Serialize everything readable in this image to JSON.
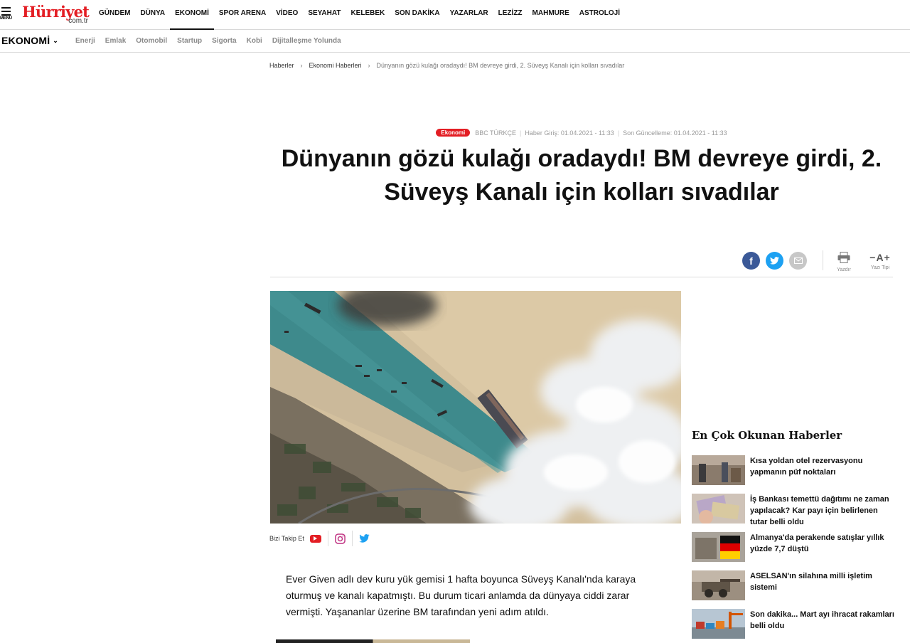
{
  "header": {
    "menu_label": "MENÜ",
    "logo_text": "Hürriyet",
    "logo_domain": "com.tr",
    "nav": [
      "GÜNDEM",
      "DÜNYA",
      "EKONOMİ",
      "SPOR ARENA",
      "VİDEO",
      "SEYAHAT",
      "KELEBEK",
      "SON DAKİKA",
      "YAZARLAR",
      "LEZİZZ",
      "MAHMURE",
      "ASTROLOJİ"
    ],
    "active_nav": "EKONOMİ"
  },
  "subheader": {
    "section": "EKONOMİ",
    "items": [
      "Enerji",
      "Emlak",
      "Otomobil",
      "Startup",
      "Sigorta",
      "Kobi",
      "Dijitalleşme Yolunda"
    ]
  },
  "breadcrumb": [
    "Haberler",
    "Ekonomi Haberleri",
    "Dünyanın gözü kulağı oradaydı! BM devreye girdi, 2. Süveyş Kanalı için kolları sıvadılar"
  ],
  "article": {
    "category": "Ekonomi",
    "source": "BBC TÜRKÇE",
    "published": "Haber Giriş: 01.04.2021 - 11:33",
    "updated": "Son Güncelleme: 01.04.2021 - 11:33",
    "title": "Dünyanın gözü kulağı oradaydı! BM devreye girdi, 2. Süveyş Kanalı için kolları sıvadılar",
    "lead": "Ever Given adlı dev kuru yük gemisi 1 hafta boyunca Süveyş Kanalı'nda karaya oturmuş ve kanalı kapatmıştı. Bu durum ticari anlamda da dünyaya ciddi zarar vermişti. Yaşananlar üzerine BM tarafından yeni adım atıldı."
  },
  "tools": {
    "print_label": "Yazdır",
    "font_label": "Yazı Tipi",
    "font_glyph": "−A+"
  },
  "follow": {
    "label": "Bizi Takip Et"
  },
  "sidebar": {
    "title": "En Çok Okunan Haberler",
    "items": [
      "Kısa yoldan otel rezervasyonu yapmanın püf noktaları",
      "İş Bankası temettü dağıtımı ne zaman yapılacak? Kar payı için belirlenen tutar belli oldu",
      "Almanya'da perakende satışlar yıllık yüzde 7,7 düştü",
      "ASELSAN'ın silahına milli işletim sistemi",
      "Son dakika... Mart ayı ihracat rakamları belli oldu"
    ]
  },
  "colors": {
    "brand": "#e31e24",
    "facebook": "#3b5998",
    "twitter": "#1da1f2"
  }
}
